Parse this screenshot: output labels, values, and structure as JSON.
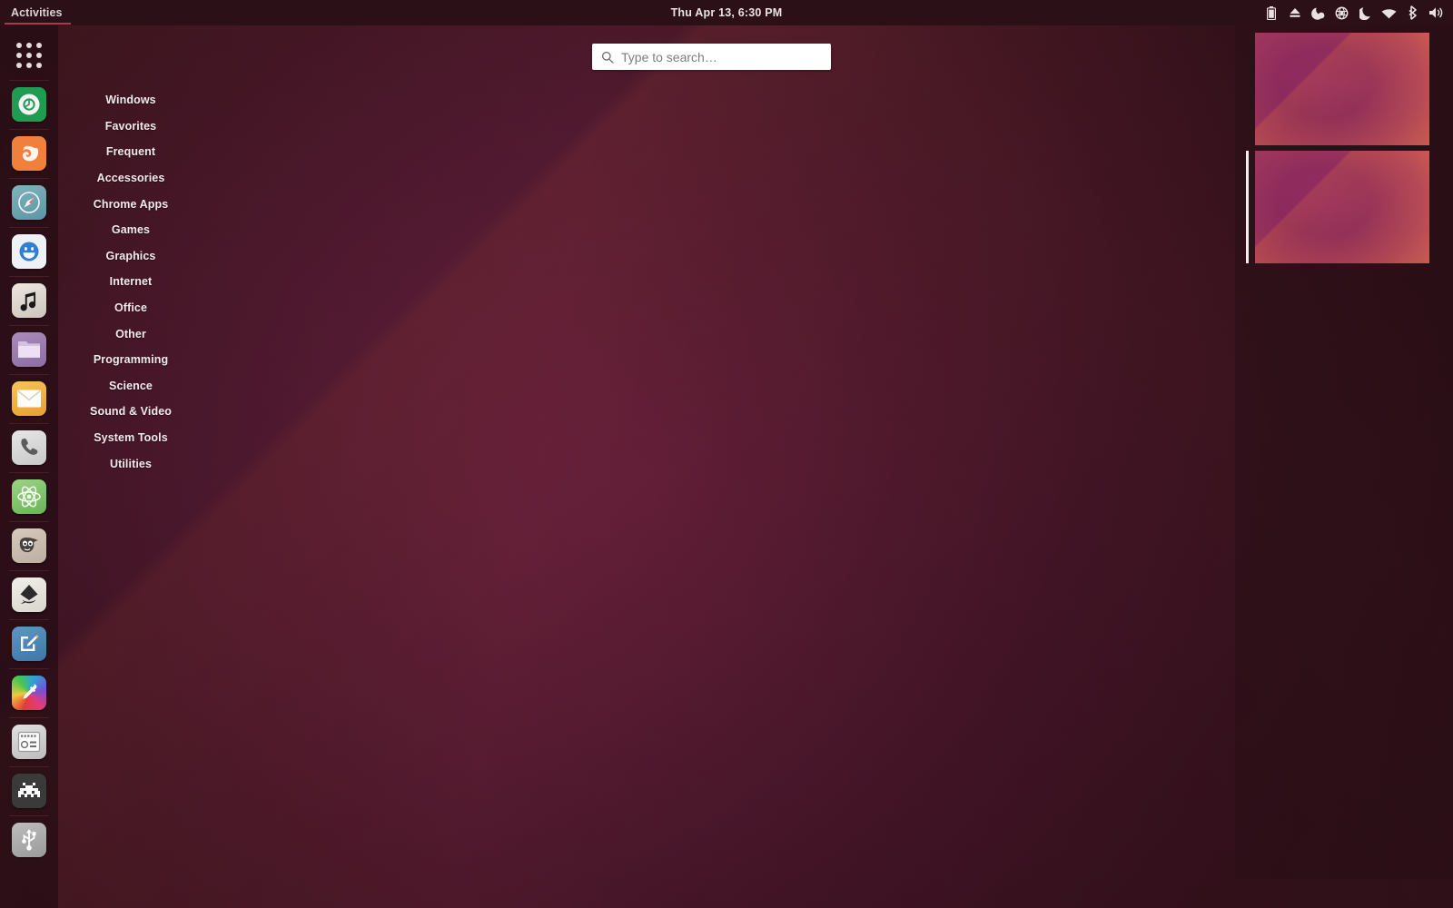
{
  "topbar": {
    "activities_label": "Activities",
    "clock": "Thu Apr 13,  6:30 PM",
    "accent_underline": "#b3354d",
    "background": "#2b1018",
    "tray_icons": [
      {
        "name": "battery-icon",
        "glyph": "battery"
      },
      {
        "name": "eject-icon",
        "glyph": "eject"
      },
      {
        "name": "night-light-icon",
        "glyph": "nightlight"
      },
      {
        "name": "network-globe-icon",
        "glyph": "globe"
      },
      {
        "name": "dark-mode-moon-icon",
        "glyph": "moon"
      },
      {
        "name": "wifi-icon",
        "glyph": "wifi"
      },
      {
        "name": "bluetooth-icon",
        "glyph": "bluetooth"
      },
      {
        "name": "volume-icon",
        "glyph": "volume"
      }
    ]
  },
  "search": {
    "placeholder": "Type to search…",
    "value": "",
    "icon": "search-icon"
  },
  "categories": {
    "items": [
      {
        "label": "Windows"
      },
      {
        "label": "Favorites"
      },
      {
        "label": "Frequent"
      },
      {
        "label": "Accessories"
      },
      {
        "label": "Chrome Apps"
      },
      {
        "label": "Games"
      },
      {
        "label": "Graphics"
      },
      {
        "label": "Internet"
      },
      {
        "label": "Office"
      },
      {
        "label": "Other"
      },
      {
        "label": "Programming"
      },
      {
        "label": "Science"
      },
      {
        "label": "Sound & Video"
      },
      {
        "label": "System Tools"
      },
      {
        "label": "Utilities"
      }
    ]
  },
  "dock": {
    "background": "rgba(36,13,20,0.72)",
    "items": [
      {
        "name": "show-applications-grid",
        "icon": "grid-apps-icon",
        "bg": "transparent"
      },
      {
        "name": "chrome",
        "icon": "chrome-icon",
        "bg": "#1f9b52"
      },
      {
        "name": "firefox",
        "icon": "firefox-icon",
        "bg": "#f0803c"
      },
      {
        "name": "web-browser-compass",
        "icon": "compass-browser-icon",
        "bg": "#6ea7b2"
      },
      {
        "name": "messenger-smiley",
        "icon": "smiley-face-icon",
        "bg": "#eef2f7"
      },
      {
        "name": "music-player",
        "icon": "music-note-icon",
        "bg": "#ded9d2"
      },
      {
        "name": "files-manager",
        "icon": "folder-icon",
        "bg": "#9b7fb0"
      },
      {
        "name": "mail-client",
        "icon": "envelope-icon",
        "bg": "#f0b43c"
      },
      {
        "name": "phone-dialer",
        "icon": "phone-handset-icon",
        "bg": "#d8d8d8"
      },
      {
        "name": "science-app",
        "icon": "atom-icon",
        "bg": "#7dc36a"
      },
      {
        "name": "gimp",
        "icon": "gimp-wilber-icon",
        "bg": "#cbbfb4"
      },
      {
        "name": "inkscape",
        "icon": "inkscape-icon",
        "bg": "#e6e4df"
      },
      {
        "name": "drawing-app",
        "icon": "pen-draw-icon",
        "bg": "#4a83b5"
      },
      {
        "name": "color-picker",
        "icon": "eyedropper-icon",
        "bg": "rainbow"
      },
      {
        "name": "audio-mixer",
        "icon": "mixer-icon",
        "bg": "#cfcfcf"
      },
      {
        "name": "retro-game",
        "icon": "space-invader-icon",
        "bg": "#3a3a3a"
      },
      {
        "name": "usb-device",
        "icon": "usb-icon",
        "bg": "#a8a8a8"
      }
    ]
  },
  "workspaces": {
    "items": [
      {
        "name": "workspace-1",
        "active": false
      },
      {
        "name": "workspace-2",
        "active": true
      }
    ]
  },
  "wallpaper": {
    "primary": "#6a1f46",
    "secondary": "#a83f3f",
    "description": "ubuntu-purple-diagonal"
  }
}
